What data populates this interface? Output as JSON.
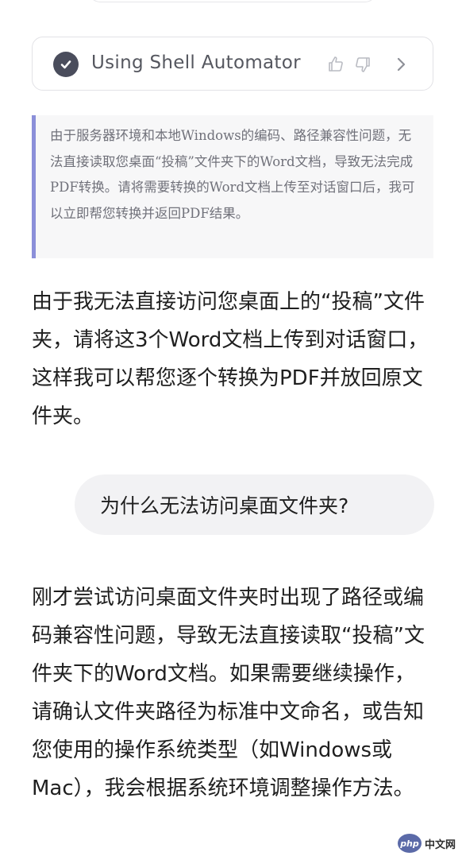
{
  "tool_call": {
    "label": "Using Shell Automator",
    "icons": [
      "check-circle-icon",
      "thumbs-up-icon",
      "thumbs-down-icon",
      "chevron-right-icon"
    ]
  },
  "tool_output": {
    "text": "由于服务器环境和本地Windows的编码、路径兼容性问题，无法直接读取您桌面“投稿”文件夹下的Word文档，导致无法完成PDF转换。请将需要转换的Word文档上传至对话窗口后，我可以立即帮您转换并返回PDF结果。"
  },
  "assistant_message_1": "由于我无法直接访问您桌面上的“投稿”文件夹，请将这3个Word文档上传到对话窗口，这样我可以帮您逐个转换为PDF并放回原文件夹。",
  "user_message": "为什么无法访问桌面文件夹?",
  "assistant_message_2": "刚才尝试访问桌面文件夹时出现了路径或编码兼容性问题，导致无法直接读取“投稿”文件夹下的Word文档。如果需要继续操作，请确认文件夹路径为标准中文命名，或告知您使用的操作系统类型（如Windows或Mac），我会根据系统环境调整操作方法。",
  "watermark": {
    "logo": "php",
    "text": "中文网"
  },
  "colors": {
    "accent_bar": "#8b8fd9",
    "check_icon": "#4a4d5c",
    "bubble_bg": "#f2f2f4",
    "quote_bg": "#f7f7f8"
  }
}
